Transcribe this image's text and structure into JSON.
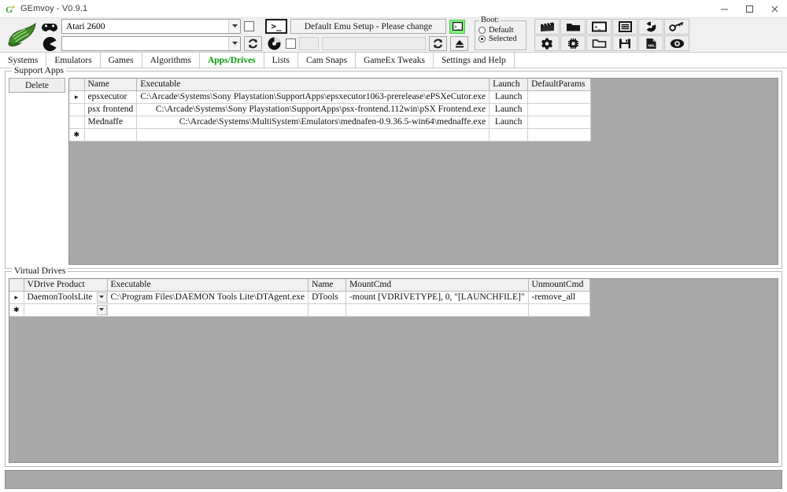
{
  "window": {
    "title": "GEmvoy - V0.9.1",
    "logo_icon": "gemvoy-logo-icon",
    "minimize_label": "Minimize",
    "maximize_label": "Maximize",
    "close_label": "Close"
  },
  "toolbar": {
    "app_logo_icon": "winged-shoe-logo-icon",
    "system_icon": "gamepad-icon",
    "game_icon": "pacman-icon",
    "system_value": "Atari 2600",
    "system_placeholder": "",
    "game_value": "",
    "game_placeholder": "",
    "system_checkbox_checked": false,
    "game_checkbox_checked": false,
    "terminal_button_glyph": ">_",
    "emu_setup_label": "Default Emu Setup - Please change",
    "emu_setup_icon": "console-window-icon",
    "refresh_icon": "refresh-icon",
    "disc_icon": "disc-icon",
    "eject_icon": "eject-icon",
    "disabled_field_small": "",
    "disabled_field_long": "",
    "boot": {
      "legend": "Boot:",
      "options": [
        {
          "label": "Default",
          "selected": false
        },
        {
          "label": "Selected",
          "selected": true
        }
      ]
    },
    "icons": [
      {
        "name": "clapperboard-icon",
        "title": "Videos"
      },
      {
        "name": "folder-filled-icon",
        "title": "Open Folder"
      },
      {
        "name": "terminal-icon",
        "title": "Command Prompt"
      },
      {
        "name": "list-icon",
        "title": "Lists"
      },
      {
        "name": "disc-wheel-icon",
        "title": "Disc"
      },
      {
        "name": "key-icon",
        "title": "Keys"
      },
      {
        "name": "gear-icon",
        "title": "Settings"
      },
      {
        "name": "chip-icon",
        "title": "Hardware"
      },
      {
        "name": "folder-outline-icon",
        "title": "Browse"
      },
      {
        "name": "save-icon",
        "title": "Save"
      },
      {
        "name": "xml-file-icon",
        "title": "XML"
      },
      {
        "name": "eye-icon",
        "title": "Preview"
      }
    ]
  },
  "tabs": [
    {
      "label": "Systems",
      "active": false
    },
    {
      "label": "Emulators",
      "active": false
    },
    {
      "label": "Games",
      "active": false
    },
    {
      "label": "Algorithms",
      "active": false
    },
    {
      "label": "Apps/Drives",
      "active": true
    },
    {
      "label": "Lists",
      "active": false
    },
    {
      "label": "Cam Snaps",
      "active": false
    },
    {
      "label": "GameEx Tweaks",
      "active": false
    },
    {
      "label": "Settings and Help",
      "active": false
    }
  ],
  "support_apps": {
    "legend": "Support Apps",
    "delete_label": "Delete",
    "columns": [
      "",
      "Name",
      "Executable",
      "Launch",
      "DefaultParams"
    ],
    "rows": [
      {
        "marker": "▸",
        "name": "epsxecutor",
        "executable": "C:\\Arcade\\Systems\\Sony Playstation\\SupportApps\\epsxecutor1063-prerelease\\ePSXeCutor.exe",
        "launch": "Launch",
        "default_params": "",
        "selected": true,
        "exec_align": "left"
      },
      {
        "marker": "",
        "name": "psx frontend",
        "executable": "C:\\Arcade\\Systems\\Sony Playstation\\SupportApps\\psx-frontend.112win\\pSX Frontend.exe",
        "launch": "Launch",
        "default_params": "",
        "selected": false,
        "exec_align": "center"
      },
      {
        "marker": "",
        "name": "Mednaffe",
        "executable": "C:\\Arcade\\Systems\\MultiSystem\\Emulators\\mednafen-0.9.36.5-win64\\mednaffe.exe",
        "launch": "Launch",
        "default_params": "",
        "selected": false,
        "exec_align": "center"
      },
      {
        "marker": "✱",
        "name": "",
        "executable": "",
        "launch": "",
        "default_params": "",
        "selected": false,
        "exec_align": "left"
      }
    ]
  },
  "virtual_drives": {
    "legend": "Virtual Drives",
    "columns": [
      "",
      "VDrive Product",
      "Executable",
      "Name",
      "MountCmd",
      "UnmountCmd"
    ],
    "rows": [
      {
        "marker": "▸",
        "product": "DaemonToolsLite",
        "executable": "C:\\Program Files\\DAEMON Tools Lite\\DTAgent.exe",
        "name": "DTools",
        "mount_cmd": "-mount [VDRIVETYPE], 0, \"[LAUNCHFILE]\"",
        "unmount_cmd": "-remove_all",
        "selected": true
      },
      {
        "marker": "✱",
        "product": "",
        "executable": "",
        "name": "",
        "mount_cmd": "",
        "unmount_cmd": "",
        "selected": false
      }
    ]
  },
  "colors": {
    "accent_green": "#069a06",
    "selection_blue": "#2f9ae8",
    "panel_gray": "#a9a9a9",
    "toolbar_gray": "#f0f0f0",
    "green_highlight": "#7ff07f"
  }
}
